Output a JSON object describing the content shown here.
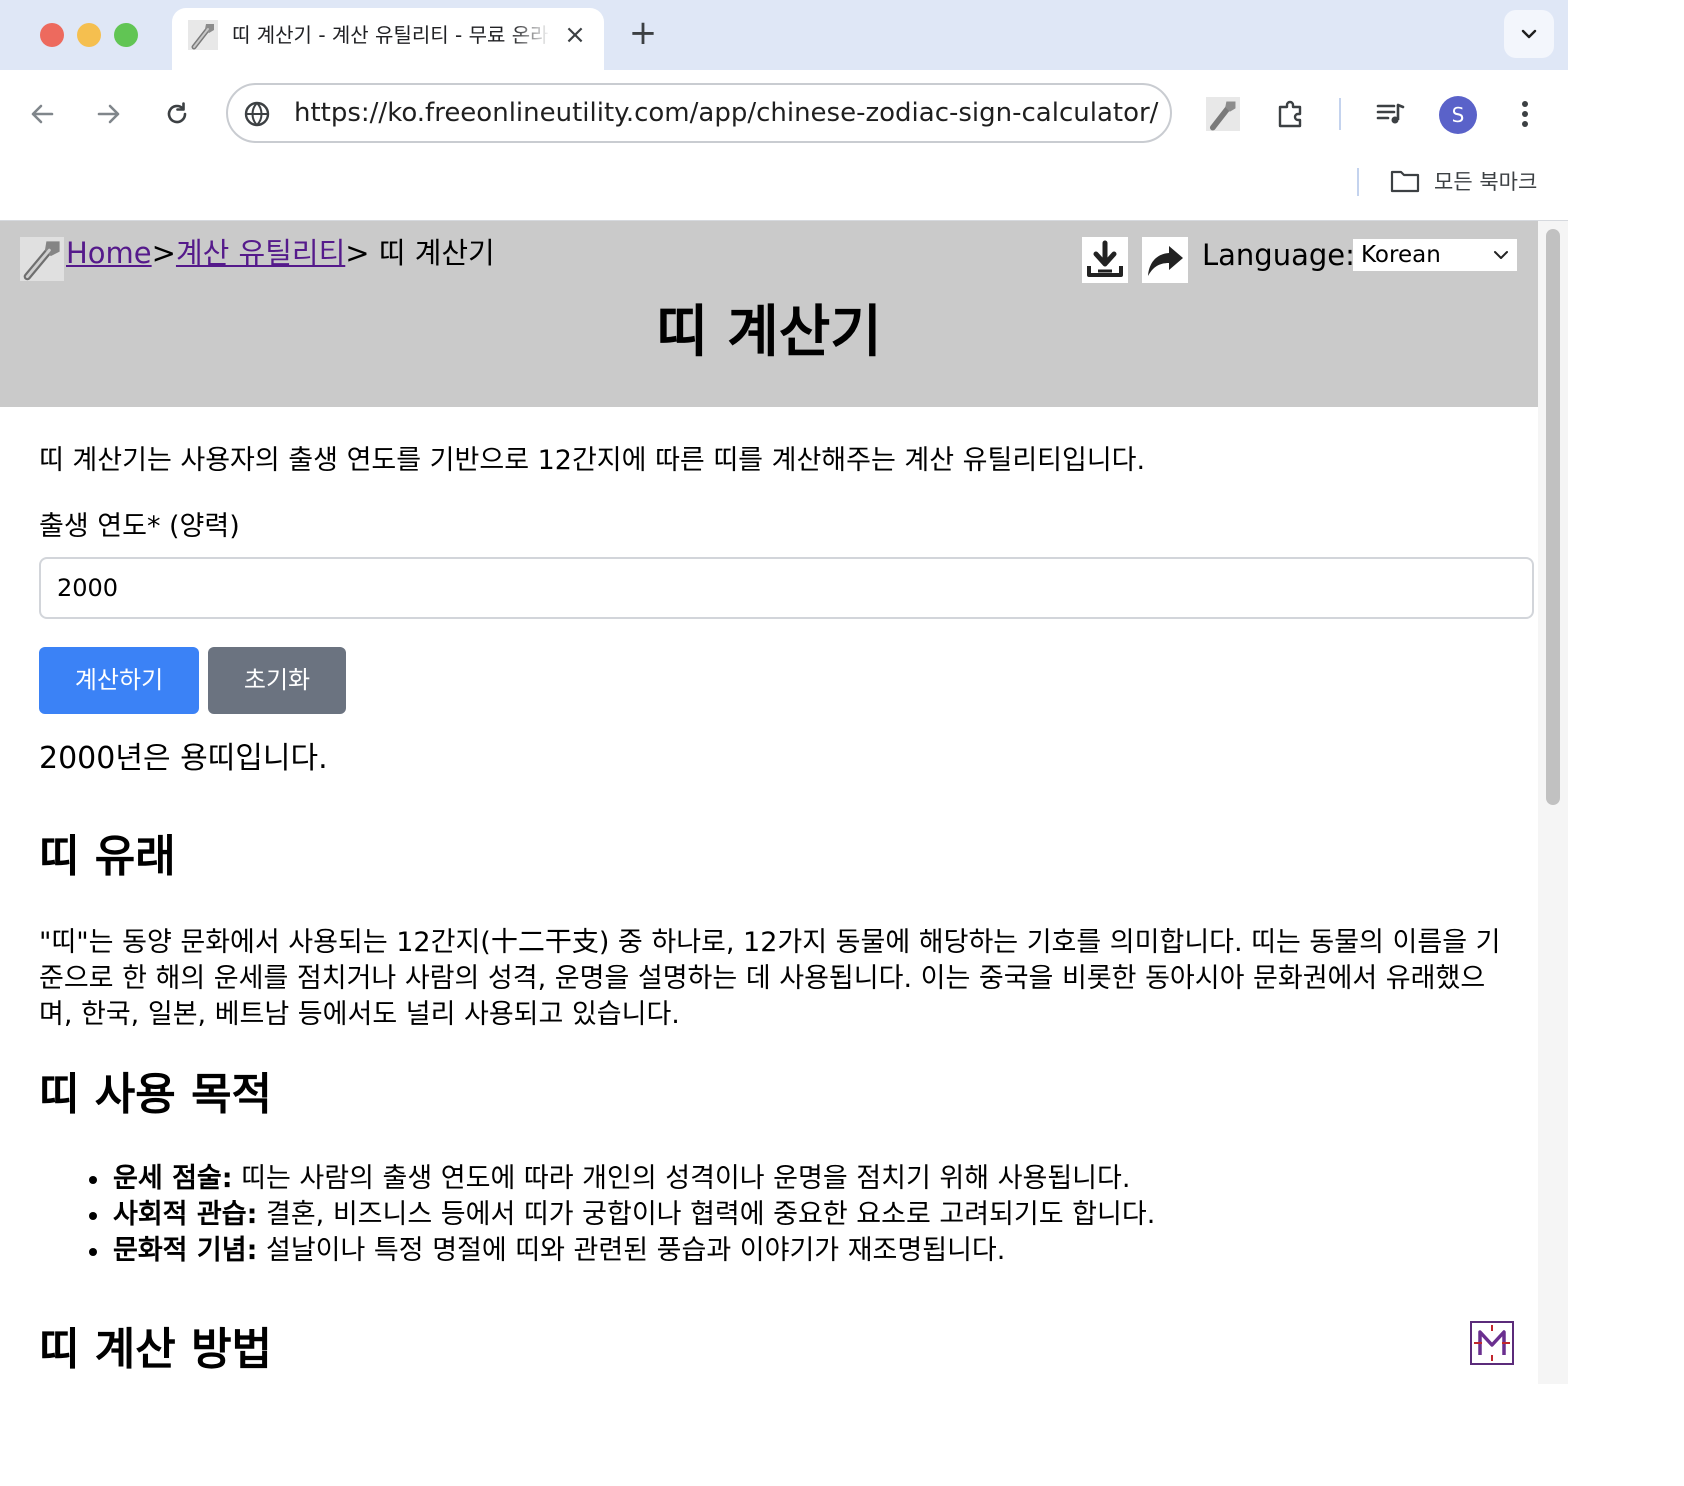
{
  "browser": {
    "tab_title": "띠 계산기 - 계산 유틸리티 - 무료 온라인 유틸리티",
    "url": "https://ko.freeonlineutility.com/app/chinese-zodiac-sign-calculator/",
    "profile_initial": "S",
    "bookmarks_label": "모든 북마크",
    "icons": {
      "back": "arrow-left-icon",
      "forward": "arrow-right-icon",
      "reload": "reload-icon",
      "site_info": "globe-icon",
      "extension": "puzzle-icon",
      "media": "media-control-icon",
      "menu": "kebab-menu-icon",
      "tab_search": "chevron-down-icon",
      "bookmarks": "folder-icon"
    }
  },
  "header": {
    "breadcrumb": {
      "home": "Home",
      "sep1": ">",
      "category": "계산 유틸리티",
      "sep2": ">",
      "current": " 띠 계산기"
    },
    "language_label": "Language:",
    "language_value": "Korean",
    "title": "띠 계산기"
  },
  "calculator": {
    "intro": "띠 계산기는 사용자의 출생 연도를 기반으로 12간지에 따른 띠를 계산해주는 계산 유틸리티입니다.",
    "field_label": "출생 연도* (양력)",
    "year_value": "2000",
    "calc_button": "계산하기",
    "reset_button": "초기화",
    "result": "2000년은 용띠입니다."
  },
  "sections": {
    "origin_heading": "띠 유래",
    "origin_text": "\"띠\"는 동양 문화에서 사용되는 12간지(十二干支) 중 하나로, 12가지 동물에 해당하는 기호를 의미합니다. 띠는 동물의 이름을 기준으로 한 해의 운세를 점치거나 사람의 성격, 운명을 설명하는 데 사용됩니다. 이는 중국을 비롯한 동아시아 문화권에서 유래했으며, 한국, 일본, 베트남 등에서도 널리 사용되고 있습니다.",
    "purpose_heading": "띠 사용 목적",
    "purpose_items": [
      {
        "term": "운세 점술:",
        "desc": " 띠는 사람의 출생 연도에 따라 개인의 성격이나 운명을 점치기 위해 사용됩니다."
      },
      {
        "term": "사회적 관습:",
        "desc": " 결혼, 비즈니스 등에서 띠가 궁합이나 협력에 중요한 요소로 고려되기도 합니다."
      },
      {
        "term": "문화적 기념:",
        "desc": " 설날이나 특정 명절에 띠와 관련된 풍습과 이야기가 재조명됩니다."
      }
    ],
    "method_heading": "띠 계산 방법"
  },
  "colors": {
    "header_bg": "#cacaca",
    "primary_button": "#3b82f6",
    "secondary_button": "#6b7380",
    "link_visited": "#551a8b"
  }
}
